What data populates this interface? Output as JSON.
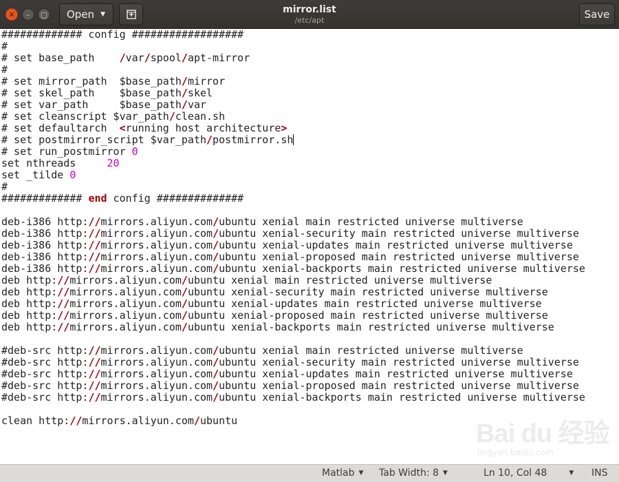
{
  "window": {
    "title": "mirror.list",
    "subtitle": "/etc/apt",
    "open_label": "Open",
    "save_label": "Save"
  },
  "icons": {
    "close": "close-icon",
    "minimize": "minimize-icon",
    "maximize": "maximize-icon",
    "new_document": "new-document-icon",
    "dropdown": "chevron-down-icon"
  },
  "colors": {
    "titlebar": "#3c3b37",
    "close_button": "#e95420",
    "slash_highlight": "#a40000",
    "keyword": "#a40000",
    "number": "#c600c6",
    "statusbar": "#dcdbd8"
  },
  "editor": {
    "cursor_line": 10,
    "lines": [
      [
        {
          "t": "############# config ##################"
        }
      ],
      [
        {
          "t": "#"
        }
      ],
      [
        {
          "t": "# set base_path    "
        },
        {
          "t": "/",
          "c": "slash"
        },
        {
          "t": "var"
        },
        {
          "t": "/",
          "c": "slash"
        },
        {
          "t": "spool"
        },
        {
          "t": "/",
          "c": "slash"
        },
        {
          "t": "apt-mirror"
        }
      ],
      [
        {
          "t": "#"
        }
      ],
      [
        {
          "t": "# set mirror_path  $base_path"
        },
        {
          "t": "/",
          "c": "slash"
        },
        {
          "t": "mirror"
        }
      ],
      [
        {
          "t": "# set skel_path    $base_path"
        },
        {
          "t": "/",
          "c": "slash"
        },
        {
          "t": "skel"
        }
      ],
      [
        {
          "t": "# set var_path     $base_path"
        },
        {
          "t": "/",
          "c": "slash"
        },
        {
          "t": "var"
        }
      ],
      [
        {
          "t": "# set cleanscript $var_path"
        },
        {
          "t": "/",
          "c": "slash"
        },
        {
          "t": "clean.sh"
        }
      ],
      [
        {
          "t": "# set defaultarch  "
        },
        {
          "t": "<",
          "c": "slash"
        },
        {
          "t": "running host architecture"
        },
        {
          "t": ">",
          "c": "slash"
        }
      ],
      [
        {
          "t": "# set postmirror_script $var_path"
        },
        {
          "t": "/",
          "c": "slash"
        },
        {
          "t": "postmirror.sh"
        }
      ],
      [
        {
          "t": "# set run_postmirror "
        },
        {
          "t": "0",
          "c": "num"
        }
      ],
      [
        {
          "t": "set nthreads     "
        },
        {
          "t": "20",
          "c": "num"
        }
      ],
      [
        {
          "t": "set _tilde "
        },
        {
          "t": "0",
          "c": "num"
        }
      ],
      [
        {
          "t": "#"
        }
      ],
      [
        {
          "t": "############# "
        },
        {
          "t": "end",
          "c": "kw"
        },
        {
          "t": " config ##############"
        }
      ],
      [],
      [
        {
          "t": "deb-i386 http:"
        },
        {
          "t": "//",
          "c": "slash"
        },
        {
          "t": "mirrors.aliyun.com"
        },
        {
          "t": "/",
          "c": "slash"
        },
        {
          "t": "ubuntu xenial main restricted universe multiverse"
        }
      ],
      [
        {
          "t": "deb-i386 http:"
        },
        {
          "t": "//",
          "c": "slash"
        },
        {
          "t": "mirrors.aliyun.com"
        },
        {
          "t": "/",
          "c": "slash"
        },
        {
          "t": "ubuntu xenial-security main restricted universe multiverse"
        }
      ],
      [
        {
          "t": "deb-i386 http:"
        },
        {
          "t": "//",
          "c": "slash"
        },
        {
          "t": "mirrors.aliyun.com"
        },
        {
          "t": "/",
          "c": "slash"
        },
        {
          "t": "ubuntu xenial-updates main restricted universe multiverse"
        }
      ],
      [
        {
          "t": "deb-i386 http:"
        },
        {
          "t": "//",
          "c": "slash"
        },
        {
          "t": "mirrors.aliyun.com"
        },
        {
          "t": "/",
          "c": "slash"
        },
        {
          "t": "ubuntu xenial-proposed main restricted universe multiverse"
        }
      ],
      [
        {
          "t": "deb-i386 http:"
        },
        {
          "t": "//",
          "c": "slash"
        },
        {
          "t": "mirrors.aliyun.com"
        },
        {
          "t": "/",
          "c": "slash"
        },
        {
          "t": "ubuntu xenial-backports main restricted universe multiverse"
        }
      ],
      [
        {
          "t": "deb http:"
        },
        {
          "t": "//",
          "c": "slash"
        },
        {
          "t": "mirrors.aliyun.com"
        },
        {
          "t": "/",
          "c": "slash"
        },
        {
          "t": "ubuntu xenial main restricted universe multiverse"
        }
      ],
      [
        {
          "t": "deb http:"
        },
        {
          "t": "//",
          "c": "slash"
        },
        {
          "t": "mirrors.aliyun.com"
        },
        {
          "t": "/",
          "c": "slash"
        },
        {
          "t": "ubuntu xenial-security main restricted universe multiverse"
        }
      ],
      [
        {
          "t": "deb http:"
        },
        {
          "t": "//",
          "c": "slash"
        },
        {
          "t": "mirrors.aliyun.com"
        },
        {
          "t": "/",
          "c": "slash"
        },
        {
          "t": "ubuntu xenial-updates main restricted universe multiverse"
        }
      ],
      [
        {
          "t": "deb http:"
        },
        {
          "t": "//",
          "c": "slash"
        },
        {
          "t": "mirrors.aliyun.com"
        },
        {
          "t": "/",
          "c": "slash"
        },
        {
          "t": "ubuntu xenial-proposed main restricted universe multiverse"
        }
      ],
      [
        {
          "t": "deb http:"
        },
        {
          "t": "//",
          "c": "slash"
        },
        {
          "t": "mirrors.aliyun.com"
        },
        {
          "t": "/",
          "c": "slash"
        },
        {
          "t": "ubuntu xenial-backports main restricted universe multiverse"
        }
      ],
      [],
      [
        {
          "t": "#deb-src http:"
        },
        {
          "t": "//",
          "c": "slash"
        },
        {
          "t": "mirrors.aliyun.com"
        },
        {
          "t": "/",
          "c": "slash"
        },
        {
          "t": "ubuntu xenial main restricted universe multiverse"
        }
      ],
      [
        {
          "t": "#deb-src http:"
        },
        {
          "t": "//",
          "c": "slash"
        },
        {
          "t": "mirrors.aliyun.com"
        },
        {
          "t": "/",
          "c": "slash"
        },
        {
          "t": "ubuntu xenial-security main restricted universe multiverse"
        }
      ],
      [
        {
          "t": "#deb-src http:"
        },
        {
          "t": "//",
          "c": "slash"
        },
        {
          "t": "mirrors.aliyun.com"
        },
        {
          "t": "/",
          "c": "slash"
        },
        {
          "t": "ubuntu xenial-updates main restricted universe multiverse"
        }
      ],
      [
        {
          "t": "#deb-src http:"
        },
        {
          "t": "//",
          "c": "slash"
        },
        {
          "t": "mirrors.aliyun.com"
        },
        {
          "t": "/",
          "c": "slash"
        },
        {
          "t": "ubuntu xenial-proposed main restricted universe multiverse"
        }
      ],
      [
        {
          "t": "#deb-src http:"
        },
        {
          "t": "//",
          "c": "slash"
        },
        {
          "t": "mirrors.aliyun.com"
        },
        {
          "t": "/",
          "c": "slash"
        },
        {
          "t": "ubuntu xenial-backports main restricted universe multiverse"
        }
      ],
      [],
      [
        {
          "t": "clean http:"
        },
        {
          "t": "//",
          "c": "slash"
        },
        {
          "t": "mirrors.aliyun.com"
        },
        {
          "t": "/",
          "c": "slash"
        },
        {
          "t": "ubuntu"
        }
      ]
    ]
  },
  "statusbar": {
    "language": "Matlab",
    "tab_width": "Tab Width: 8",
    "position": "Ln 10, Col 48",
    "mode": "INS"
  },
  "watermark": {
    "brand": "Bai du 经验",
    "url": "jingyan.baidu.com"
  }
}
